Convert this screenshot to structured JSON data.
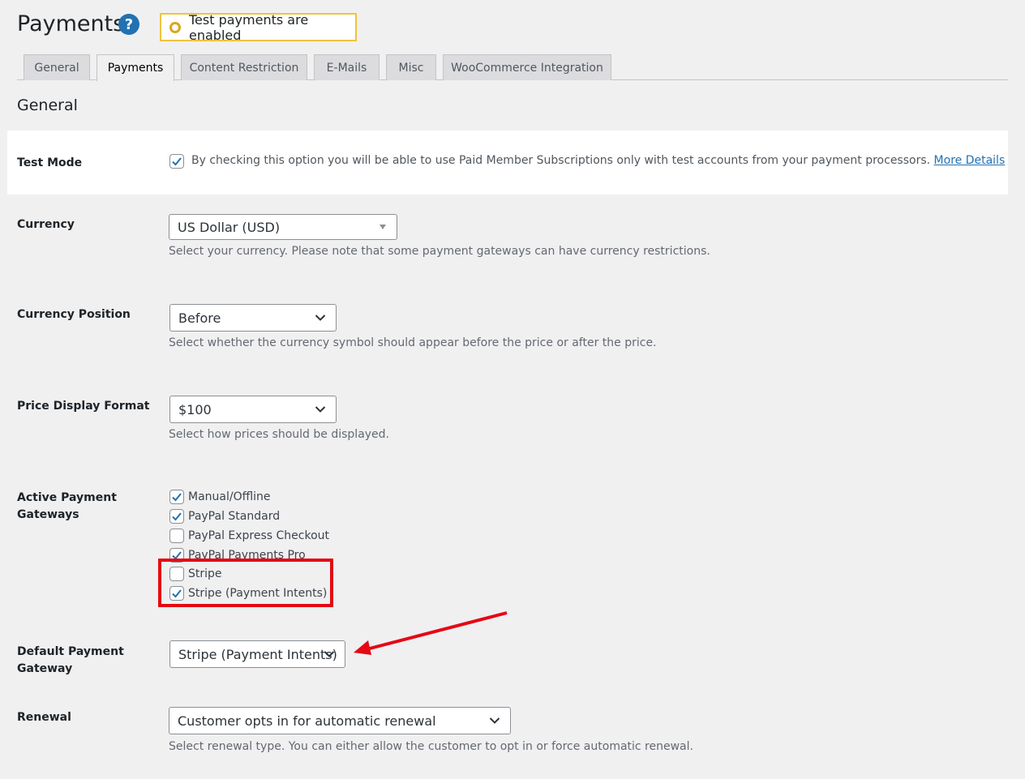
{
  "header": {
    "title": "Payments",
    "help_icon": "?",
    "test_notice": "Test payments are enabled"
  },
  "tabs": [
    "General",
    "Payments",
    "Content Restriction",
    "E-Mails",
    "Misc",
    "WooCommerce Integration"
  ],
  "active_tab": "Payments",
  "section_title": "General",
  "test_mode": {
    "label": "Test Mode",
    "checked": true,
    "description": "By checking this option you will be able to use Paid Member Subscriptions only with test accounts from your payment processors.",
    "link": "More Details"
  },
  "currency": {
    "label": "Currency",
    "value": "US Dollar (USD)",
    "description": "Select your currency. Please note that some payment gateways can have currency restrictions."
  },
  "currency_position": {
    "label": "Currency Position",
    "value": "Before",
    "description": "Select whether the currency symbol should appear before the price or after the price."
  },
  "price_display": {
    "label": "Price Display Format",
    "value": "$100",
    "description": "Select how prices should be displayed."
  },
  "gateways": {
    "label_line1": "Active Payment",
    "label_line2": "Gateways",
    "items": [
      {
        "label": "Manual/Offline",
        "checked": true
      },
      {
        "label": "PayPal Standard",
        "checked": true
      },
      {
        "label": "PayPal Express Checkout",
        "checked": false
      },
      {
        "label": "PayPal Payments Pro",
        "checked": true
      },
      {
        "label": "Stripe",
        "checked": false
      },
      {
        "label": "Stripe (Payment Intents)",
        "checked": true
      }
    ]
  },
  "default_gateway": {
    "label_line1": "Default Payment",
    "label_line2": "Gateway",
    "value": "Stripe (Payment Intents)"
  },
  "renewal": {
    "label": "Renewal",
    "value": "Customer opts in for automatic renewal",
    "description": "Select renewal type. You can either allow the customer to opt in or force automatic renewal."
  },
  "colors": {
    "accent": "#2271b1",
    "annotation": "#e50914",
    "notice_border": "#f0c33c"
  }
}
